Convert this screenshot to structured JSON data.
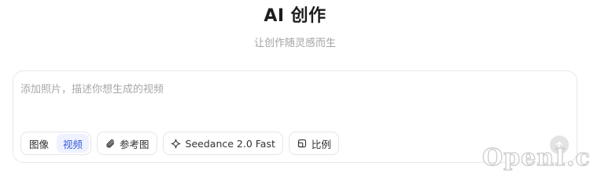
{
  "header": {
    "title": "AI 创作",
    "subtitle": "让创作随灵感而生"
  },
  "composer": {
    "placeholder": "添加照片，描述你想生成的视频",
    "value": "",
    "mode_toggle": {
      "options": [
        {
          "label": "图像",
          "active": false
        },
        {
          "label": "视频",
          "active": true
        }
      ]
    },
    "reference_label": "参考图",
    "model_label": "Seedance 2.0 Fast",
    "ratio_label": "比例",
    "send_icon": "arrow-up-icon"
  },
  "watermark": {
    "text": "OpenI.cn"
  },
  "colors": {
    "accent": "#3b5bdb",
    "accent_bg": "#eef2ff",
    "border": "#e6e6e8",
    "muted_text": "#a3a3a3"
  }
}
